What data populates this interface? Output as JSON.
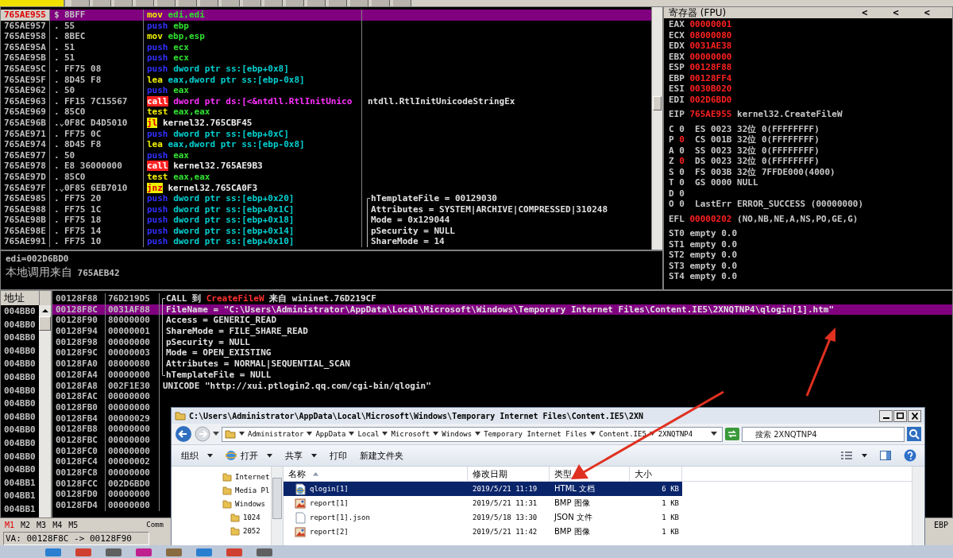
{
  "disassembly": {
    "rows": [
      {
        "address": "765AE955",
        "marker": "$",
        "hex": "8BFF",
        "mnemonic": "mov",
        "kind": "move",
        "operand": {
          "text": "edi,edi",
          "kind": "register"
        },
        "selected": true
      },
      {
        "address": "765AE957",
        "marker": ".",
        "hex": "55",
        "mnemonic": "push",
        "kind": "push",
        "operand": {
          "text": "ebp",
          "kind": "register"
        },
        "selected": false
      },
      {
        "address": "765AE958",
        "marker": ".",
        "hex": "8BEC",
        "mnemonic": "mov",
        "kind": "move",
        "operand": {
          "text": "ebp,esp",
          "kind": "register"
        },
        "selected": false
      },
      {
        "address": "765AE95A",
        "marker": ".",
        "hex": "51",
        "mnemonic": "push",
        "kind": "push",
        "operand": {
          "text": "ecx",
          "kind": "register"
        },
        "selected": false
      },
      {
        "address": "765AE95B",
        "marker": ".",
        "hex": "51",
        "mnemonic": "push",
        "kind": "push",
        "operand": {
          "text": "ecx",
          "kind": "register"
        },
        "selected": false
      },
      {
        "address": "765AE95C",
        "marker": ".",
        "hex": "FF75 08",
        "mnemonic": "push",
        "kind": "push",
        "operand": {
          "text": "dword ptr ss:[ebp+0x8]",
          "kind": "memory"
        },
        "selected": false
      },
      {
        "address": "765AE95F",
        "marker": ".",
        "hex": "8D45 F8",
        "mnemonic": "lea",
        "kind": "move",
        "operand": {
          "text": "eax,dword ptr ss:[ebp-0x8]",
          "kind": "memory"
        },
        "selected": false
      },
      {
        "address": "765AE962",
        "marker": ".",
        "hex": "50",
        "mnemonic": "push",
        "kind": "push",
        "operand": {
          "text": "eax",
          "kind": "register"
        },
        "selected": false
      },
      {
        "address": "765AE963",
        "marker": ".",
        "hex": "FF15 7C15567",
        "mnemonic": "call",
        "kind": "call",
        "operand": {
          "text": "dword ptr ds:[<&ntdll.RtlInitUnico",
          "kind": "import"
        },
        "comment": "ntdll.RtlInitUnicodeStringEx",
        "selected": false
      },
      {
        "address": "765AE969",
        "marker": ".",
        "hex": "85C0",
        "mnemonic": "test",
        "kind": "move",
        "operand": {
          "text": "eax,eax",
          "kind": "register"
        },
        "selected": false
      },
      {
        "address": "765AE96B",
        "marker": ".⌄",
        "hex": "0F8C D4D5010",
        "mnemonic": "jl",
        "kind": "jump",
        "operand": {
          "text": "kernel32.765CBF45",
          "kind": "label"
        },
        "selected": false
      },
      {
        "address": "765AE971",
        "marker": ".",
        "hex": "FF75 0C",
        "mnemonic": "push",
        "kind": "push",
        "operand": {
          "text": "dword ptr ss:[ebp+0xC]",
          "kind": "memory"
        },
        "selected": false
      },
      {
        "address": "765AE974",
        "marker": ".",
        "hex": "8D45 F8",
        "mnemonic": "lea",
        "kind": "move",
        "operand": {
          "text": "eax,dword ptr ss:[ebp-0x8]",
          "kind": "memory"
        },
        "selected": false
      },
      {
        "address": "765AE977",
        "marker": ".",
        "hex": "50",
        "mnemonic": "push",
        "kind": "push",
        "operand": {
          "text": "eax",
          "kind": "register"
        },
        "selected": false
      },
      {
        "address": "765AE978",
        "marker": ".",
        "hex": "E8 36000000",
        "mnemonic": "call",
        "kind": "call",
        "operand": {
          "text": "kernel32.765AE9B3",
          "kind": "label"
        },
        "selected": false
      },
      {
        "address": "765AE97D",
        "marker": ".",
        "hex": "85C0",
        "mnemonic": "test",
        "kind": "move",
        "operand": {
          "text": "eax,eax",
          "kind": "register"
        },
        "selected": false
      },
      {
        "address": "765AE97F",
        "marker": ".⌄",
        "hex": "0F85 6EB7010",
        "mnemonic": "jnz",
        "kind": "jump",
        "operand": {
          "text": "kernel32.765CA0F3",
          "kind": "label"
        },
        "selected": false
      },
      {
        "address": "765AE985",
        "marker": ".",
        "hex": "FF75 20",
        "mnemonic": "push",
        "kind": "push",
        "operand": {
          "text": "dword ptr ss:[ebp+0x20]",
          "kind": "memory"
        },
        "comment": "hTemplateFile = 00129030",
        "bracket": {
          "kind": "top"
        },
        "selected": false
      },
      {
        "address": "765AE988",
        "marker": ".",
        "hex": "FF75 1C",
        "mnemonic": "push",
        "kind": "push",
        "operand": {
          "text": "dword ptr ss:[ebp+0x1C]",
          "kind": "memory"
        },
        "comment": "Attributes = SYSTEM|ARCHIVE|COMPRESSED|310248",
        "bracket": {
          "kind": "mid"
        },
        "selected": false
      },
      {
        "address": "765AE98B",
        "marker": ".",
        "hex": "FF75 18",
        "mnemonic": "push",
        "kind": "push",
        "operand": {
          "text": "dword ptr ss:[ebp+0x18]",
          "kind": "memory"
        },
        "comment": "Mode = 0x129044",
        "bracket": {
          "kind": "mid"
        },
        "selected": false
      },
      {
        "address": "765AE98E",
        "marker": ".",
        "hex": "FF75 14",
        "mnemonic": "push",
        "kind": "push",
        "operand": {
          "text": "dword ptr ss:[ebp+0x14]",
          "kind": "memory"
        },
        "comment": "pSecurity = NULL",
        "bracket": {
          "kind": "mid"
        },
        "selected": false
      },
      {
        "address": "765AE991",
        "marker": ".",
        "hex": "FF75 10",
        "mnemonic": "push",
        "kind": "push",
        "operand": {
          "text": "dword ptr ss:[ebp+0x10]",
          "kind": "memory"
        },
        "comment": "ShareMode = 14",
        "bracket": {
          "kind": "mid"
        },
        "selected": false
      }
    ]
  },
  "info": {
    "lines": [
      "edi=002D6BD0"
    ],
    "caller_label": "本地调用来自",
    "caller_address": "765AEB42"
  },
  "registers": {
    "title": "寄存器 (FPU)",
    "nav": [
      "<",
      "<",
      "<"
    ],
    "general": [
      {
        "name": "EAX",
        "value": "00000001",
        "changed": true
      },
      {
        "name": "ECX",
        "value": "08000080",
        "changed": true
      },
      {
        "name": "EDX",
        "value": "0031AE38",
        "changed": true
      },
      {
        "name": "EBX",
        "value": "00000000",
        "changed": true
      },
      {
        "name": "ESP",
        "value": "00128F88",
        "changed": true
      },
      {
        "name": "EBP",
        "value": "00128FF4",
        "changed": true
      },
      {
        "name": "ESI",
        "value": "0030B020",
        "changed": true
      },
      {
        "name": "EDI",
        "value": "002D6BD0",
        "changed": true
      }
    ],
    "eip": {
      "name": "EIP",
      "value": "765AE955",
      "changed": true,
      "comment": "kernel32.CreateFileW"
    },
    "flags": [
      {
        "flag": "C",
        "bit": "0",
        "changed": false,
        "detail": "ES 0023 32位 0(FFFFFFFF)"
      },
      {
        "flag": "P",
        "bit": "0",
        "changed": true,
        "detail": "CS 001B 32位 0(FFFFFFFF)"
      },
      {
        "flag": "A",
        "bit": "0",
        "changed": false,
        "detail": "SS 0023 32位 0(FFFFFFFF)"
      },
      {
        "flag": "Z",
        "bit": "0",
        "changed": true,
        "detail": "DS 0023 32位 0(FFFFFFFF)"
      },
      {
        "flag": "S",
        "bit": "0",
        "changed": false,
        "detail": "FS 003B 32位 7FFDE000(4000)"
      },
      {
        "flag": "T",
        "bit": "0",
        "changed": false,
        "detail": "GS 0000 NULL"
      },
      {
        "flag": "D",
        "bit": "0",
        "changed": false
      },
      {
        "flag": "O",
        "bit": "0",
        "changed": false,
        "detail": "LastErr ERROR_SUCCESS (00000000)"
      }
    ],
    "efl": {
      "name": "EFL",
      "value": "00000202",
      "changed": true,
      "comment": "(NO,NB,NE,A,NS,PO,GE,G)"
    },
    "fpu": [
      {
        "name": "ST0",
        "value": "empty 0.0"
      },
      {
        "name": "ST1",
        "value": "empty 0.0"
      },
      {
        "name": "ST2",
        "value": "empty 0.0"
      },
      {
        "name": "ST3",
        "value": "empty 0.0"
      },
      {
        "name": "ST4",
        "value": "empty 0.0"
      }
    ]
  },
  "dump": {
    "header": "地址",
    "rows": [
      "004BB0",
      "004BB0",
      "004BB0",
      "004BB0",
      "004BB0",
      "004BB0",
      "004BB0",
      "004BB0",
      "004BB0",
      "004BB0",
      "004BB0",
      "004BB0",
      "004BB0",
      "004BB1",
      "004BB1",
      "004BB1"
    ]
  },
  "stack": {
    "rows": [
      {
        "address": "00128F88",
        "value": "76D219D5",
        "comment": "CALL 到 ",
        "call_target": "CreateFileW",
        "comment_tail": " 来自 wininet.76D219CF",
        "bracket": {
          "kind": "top"
        },
        "selected": false
      },
      {
        "address": "00128F8C",
        "value": "0031AF88",
        "comment": "FileName = \"C:\\Users\\Administrator\\AppData\\Local\\Microsoft\\Windows\\Temporary Internet Files\\Content.IE5\\2XNQTNP4\\qlogin[1].htm\"",
        "bracket": {
          "kind": "mid"
        },
        "selected": true
      },
      {
        "address": "00128F90",
        "value": "80000000",
        "comment": "Access = GENERIC_READ",
        "bracket": {
          "kind": "mid"
        },
        "selected": false
      },
      {
        "address": "00128F94",
        "value": "00000001",
        "comment": "ShareMode = FILE_SHARE_READ",
        "bracket": {
          "kind": "mid"
        },
        "selected": false
      },
      {
        "address": "00128F98",
        "value": "00000000",
        "comment": "pSecurity = NULL",
        "bracket": {
          "kind": "mid"
        },
        "selected": false
      },
      {
        "address": "00128F9C",
        "value": "00000003",
        "comment": "Mode = OPEN_EXISTING",
        "bracket": {
          "kind": "mid"
        },
        "selected": false
      },
      {
        "address": "00128FA0",
        "value": "08000080",
        "comment": "Attributes = NORMAL|SEQUENTIAL_SCAN",
        "bracket": {
          "kind": "mid"
        },
        "selected": false
      },
      {
        "address": "00128FA4",
        "value": "00000000",
        "comment": "hTemplateFile = NULL",
        "bracket": {
          "kind": "end"
        },
        "selected": false
      },
      {
        "address": "00128FA8",
        "value": "002F1E30",
        "comment": "UNICODE \"http://xui.ptlogin2.qq.com/cgi-bin/qlogin\"",
        "selected": false
      },
      {
        "address": "00128FAC",
        "value": "00000000",
        "selected": false
      },
      {
        "address": "00128FB0",
        "value": "00000000",
        "selected": false
      },
      {
        "address": "00128FB4",
        "value": "00000029",
        "selected": false
      },
      {
        "address": "00128FB8",
        "value": "00000000",
        "selected": false
      },
      {
        "address": "00128FBC",
        "value": "00000000",
        "selected": false
      },
      {
        "address": "00128FC0",
        "value": "00000000",
        "selected": false
      },
      {
        "address": "00128FC4",
        "value": "00000002",
        "selected": false
      },
      {
        "address": "00128FC8",
        "value": "00000000",
        "selected": false
      },
      {
        "address": "00128FCC",
        "value": "002D6BD0",
        "selected": false
      },
      {
        "address": "00128FD0",
        "value": "00000000",
        "selected": false
      },
      {
        "address": "00128FD4",
        "value": "00000000",
        "selected": false
      }
    ]
  },
  "memory_tabs": [
    {
      "label": "M1",
      "selected": true
    },
    {
      "label": "M2",
      "selected": false
    },
    {
      "label": "M3",
      "selected": false
    },
    {
      "label": "M4",
      "selected": false
    },
    {
      "label": "M5",
      "selected": false
    }
  ],
  "command_label": "Comm",
  "register_hint": "EBP",
  "status_bar": {
    "text": "VA: 00128F8C -> 00128F90"
  },
  "explorer": {
    "title": "C:\\Users\\Administrator\\AppData\\Local\\Microsoft\\Windows\\Temporary Internet Files\\Content.IE5\\2XN",
    "breadcrumb": [
      "Administrator",
      "AppData",
      "Local",
      "Microsoft",
      "Windows",
      "Temporary Internet Files",
      "Content.IE5",
      "2XNQTNP4"
    ],
    "search": {
      "placeholder": "搜索 2XNQTNP4"
    },
    "toolbar": [
      {
        "label": "组织",
        "kind": "menu",
        "dropdown": true
      },
      {
        "label": "打开",
        "kind": "open",
        "dropdown": true
      },
      {
        "label": "共享",
        "kind": "menu",
        "dropdown": true
      },
      {
        "label": "打印",
        "kind": "plain",
        "dropdown": false
      },
      {
        "label": "新建文件夹",
        "kind": "plain",
        "dropdown": false
      }
    ],
    "tree": [
      {
        "label": "Internet"
      },
      {
        "label": "Media Pl"
      },
      {
        "label": "Windows",
        "children": [
          {
            "label": "1024"
          },
          {
            "label": "2052"
          }
        ]
      }
    ],
    "columns": [
      {
        "label": "名称",
        "sorted": true
      },
      {
        "label": "修改日期",
        "sorted": false
      },
      {
        "label": "类型",
        "sorted": false
      },
      {
        "label": "大小",
        "sorted": false
      }
    ],
    "files": [
      {
        "name": "qlogin[1]",
        "date": "2019/5/21 11:19",
        "type": "HTML 文档",
        "size": "6 KB",
        "kind": "html",
        "selected": true
      },
      {
        "name": "report[1]",
        "date": "2019/5/21 11:31",
        "type": "BMP 图像",
        "size": "1 KB",
        "kind": "image",
        "selected": false
      },
      {
        "name": "report[1].json",
        "date": "2019/5/18 13:30",
        "type": "JSON 文件",
        "size": "1 KB",
        "kind": "file",
        "selected": false
      },
      {
        "name": "report[2]",
        "date": "2019/5/21 11:42",
        "type": "BMP 图像",
        "size": "1 KB",
        "kind": "image",
        "selected": false
      }
    ]
  }
}
